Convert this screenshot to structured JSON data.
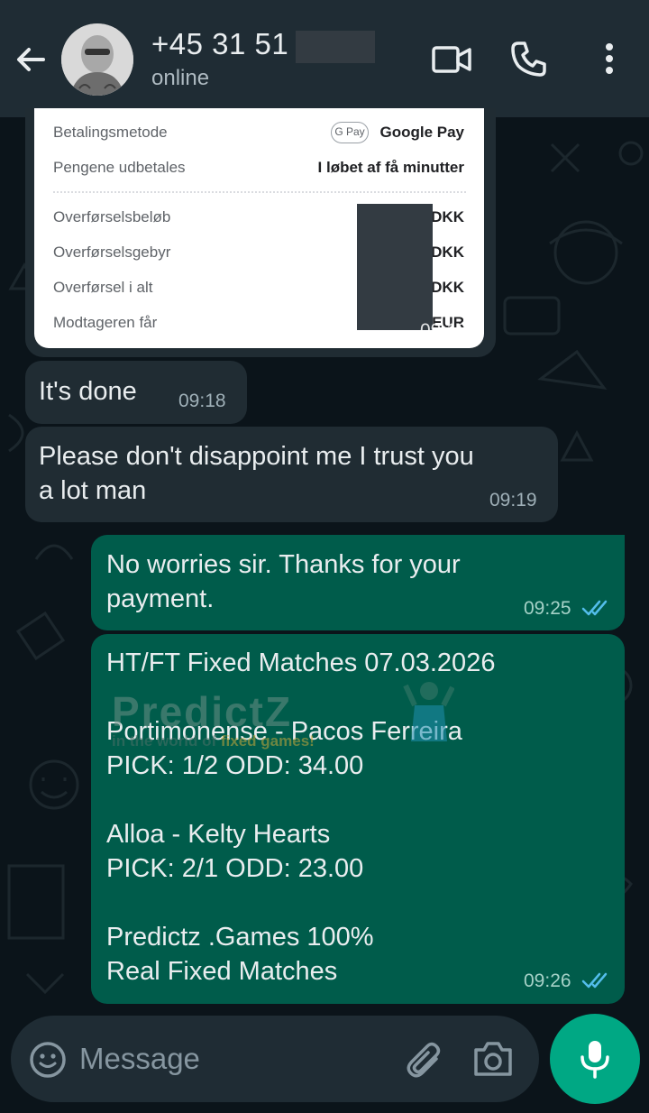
{
  "header": {
    "contact_name": "+45 31 51",
    "status": "online"
  },
  "receipt": {
    "rows": [
      {
        "label": "Betalingsmetode",
        "value": "Google Pay",
        "badge": "G Pay"
      },
      {
        "label": "Pengene udbetales",
        "value": "I løbet af få minutter"
      },
      {
        "label": "Overførselsbeløb",
        "value": "DKK"
      },
      {
        "label": "Overførselsgebyr",
        "value": "DKK"
      },
      {
        "label": "Overførsel i alt",
        "value": "DKK"
      },
      {
        "label": "Modtageren får",
        "value": "EUR"
      }
    ],
    "time": "09:18"
  },
  "messages": [
    {
      "direction": "incoming",
      "text": "It's done",
      "time": "09:18"
    },
    {
      "direction": "incoming",
      "text": "Please don't disappoint me I trust you\na lot man",
      "time": "09:19"
    },
    {
      "direction": "outgoing",
      "text": "No worries sir. Thanks for your\npayment.",
      "time": "09:25",
      "status": "read"
    },
    {
      "direction": "outgoing",
      "text": "HT/FT Fixed Matches 07.03.2026\n\nPortimonense - Pacos Ferreira\nPICK: 1/2 ODD: 34.00\n\nAlloa - Kelty Hearts\nPICK: 2/1  ODD: 23.00\n\nPredictz .Games 100%\nReal Fixed Matches",
      "time": "09:26",
      "status": "read"
    }
  ],
  "watermark": {
    "brand": "PredictZ",
    "tagline_prefix": "in the world of",
    "tagline_highlight": "fixed games!"
  },
  "composer": {
    "placeholder": "Message"
  },
  "colors": {
    "header_bg": "#1f2c34",
    "chat_bg": "#0b141a",
    "incoming_bubble": "#202c33",
    "outgoing_bubble": "#005c4b",
    "accent": "#00a884",
    "read_ticks": "#53bdeb"
  },
  "icons": [
    "back-arrow-icon",
    "video-call-icon",
    "phone-icon",
    "more-vert-icon",
    "emoji-icon",
    "attach-icon",
    "camera-icon",
    "mic-icon",
    "double-check-icon"
  ]
}
